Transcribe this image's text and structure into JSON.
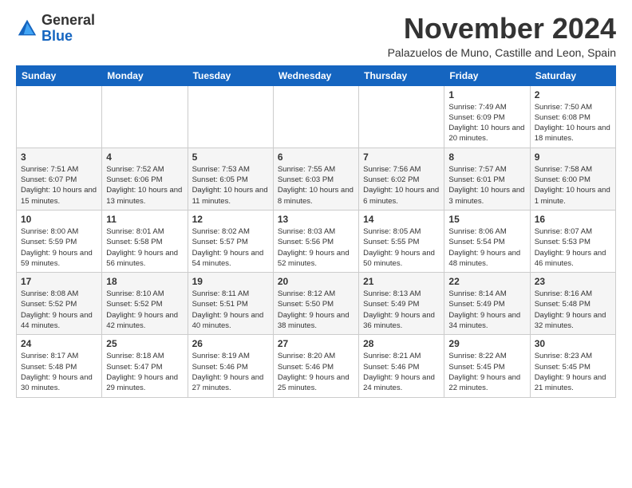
{
  "logo": {
    "general": "General",
    "blue": "Blue"
  },
  "header": {
    "month_year": "November 2024",
    "location": "Palazuelos de Muno, Castille and Leon, Spain"
  },
  "weekdays": [
    "Sunday",
    "Monday",
    "Tuesday",
    "Wednesday",
    "Thursday",
    "Friday",
    "Saturday"
  ],
  "weeks": [
    [
      {
        "day": "",
        "info": ""
      },
      {
        "day": "",
        "info": ""
      },
      {
        "day": "",
        "info": ""
      },
      {
        "day": "",
        "info": ""
      },
      {
        "day": "",
        "info": ""
      },
      {
        "day": "1",
        "info": "Sunrise: 7:49 AM\nSunset: 6:09 PM\nDaylight: 10 hours and 20 minutes."
      },
      {
        "day": "2",
        "info": "Sunrise: 7:50 AM\nSunset: 6:08 PM\nDaylight: 10 hours and 18 minutes."
      }
    ],
    [
      {
        "day": "3",
        "info": "Sunrise: 7:51 AM\nSunset: 6:07 PM\nDaylight: 10 hours and 15 minutes."
      },
      {
        "day": "4",
        "info": "Sunrise: 7:52 AM\nSunset: 6:06 PM\nDaylight: 10 hours and 13 minutes."
      },
      {
        "day": "5",
        "info": "Sunrise: 7:53 AM\nSunset: 6:05 PM\nDaylight: 10 hours and 11 minutes."
      },
      {
        "day": "6",
        "info": "Sunrise: 7:55 AM\nSunset: 6:03 PM\nDaylight: 10 hours and 8 minutes."
      },
      {
        "day": "7",
        "info": "Sunrise: 7:56 AM\nSunset: 6:02 PM\nDaylight: 10 hours and 6 minutes."
      },
      {
        "day": "8",
        "info": "Sunrise: 7:57 AM\nSunset: 6:01 PM\nDaylight: 10 hours and 3 minutes."
      },
      {
        "day": "9",
        "info": "Sunrise: 7:58 AM\nSunset: 6:00 PM\nDaylight: 10 hours and 1 minute."
      }
    ],
    [
      {
        "day": "10",
        "info": "Sunrise: 8:00 AM\nSunset: 5:59 PM\nDaylight: 9 hours and 59 minutes."
      },
      {
        "day": "11",
        "info": "Sunrise: 8:01 AM\nSunset: 5:58 PM\nDaylight: 9 hours and 56 minutes."
      },
      {
        "day": "12",
        "info": "Sunrise: 8:02 AM\nSunset: 5:57 PM\nDaylight: 9 hours and 54 minutes."
      },
      {
        "day": "13",
        "info": "Sunrise: 8:03 AM\nSunset: 5:56 PM\nDaylight: 9 hours and 52 minutes."
      },
      {
        "day": "14",
        "info": "Sunrise: 8:05 AM\nSunset: 5:55 PM\nDaylight: 9 hours and 50 minutes."
      },
      {
        "day": "15",
        "info": "Sunrise: 8:06 AM\nSunset: 5:54 PM\nDaylight: 9 hours and 48 minutes."
      },
      {
        "day": "16",
        "info": "Sunrise: 8:07 AM\nSunset: 5:53 PM\nDaylight: 9 hours and 46 minutes."
      }
    ],
    [
      {
        "day": "17",
        "info": "Sunrise: 8:08 AM\nSunset: 5:52 PM\nDaylight: 9 hours and 44 minutes."
      },
      {
        "day": "18",
        "info": "Sunrise: 8:10 AM\nSunset: 5:52 PM\nDaylight: 9 hours and 42 minutes."
      },
      {
        "day": "19",
        "info": "Sunrise: 8:11 AM\nSunset: 5:51 PM\nDaylight: 9 hours and 40 minutes."
      },
      {
        "day": "20",
        "info": "Sunrise: 8:12 AM\nSunset: 5:50 PM\nDaylight: 9 hours and 38 minutes."
      },
      {
        "day": "21",
        "info": "Sunrise: 8:13 AM\nSunset: 5:49 PM\nDaylight: 9 hours and 36 minutes."
      },
      {
        "day": "22",
        "info": "Sunrise: 8:14 AM\nSunset: 5:49 PM\nDaylight: 9 hours and 34 minutes."
      },
      {
        "day": "23",
        "info": "Sunrise: 8:16 AM\nSunset: 5:48 PM\nDaylight: 9 hours and 32 minutes."
      }
    ],
    [
      {
        "day": "24",
        "info": "Sunrise: 8:17 AM\nSunset: 5:48 PM\nDaylight: 9 hours and 30 minutes."
      },
      {
        "day": "25",
        "info": "Sunrise: 8:18 AM\nSunset: 5:47 PM\nDaylight: 9 hours and 29 minutes."
      },
      {
        "day": "26",
        "info": "Sunrise: 8:19 AM\nSunset: 5:46 PM\nDaylight: 9 hours and 27 minutes."
      },
      {
        "day": "27",
        "info": "Sunrise: 8:20 AM\nSunset: 5:46 PM\nDaylight: 9 hours and 25 minutes."
      },
      {
        "day": "28",
        "info": "Sunrise: 8:21 AM\nSunset: 5:46 PM\nDaylight: 9 hours and 24 minutes."
      },
      {
        "day": "29",
        "info": "Sunrise: 8:22 AM\nSunset: 5:45 PM\nDaylight: 9 hours and 22 minutes."
      },
      {
        "day": "30",
        "info": "Sunrise: 8:23 AM\nSunset: 5:45 PM\nDaylight: 9 hours and 21 minutes."
      }
    ]
  ]
}
